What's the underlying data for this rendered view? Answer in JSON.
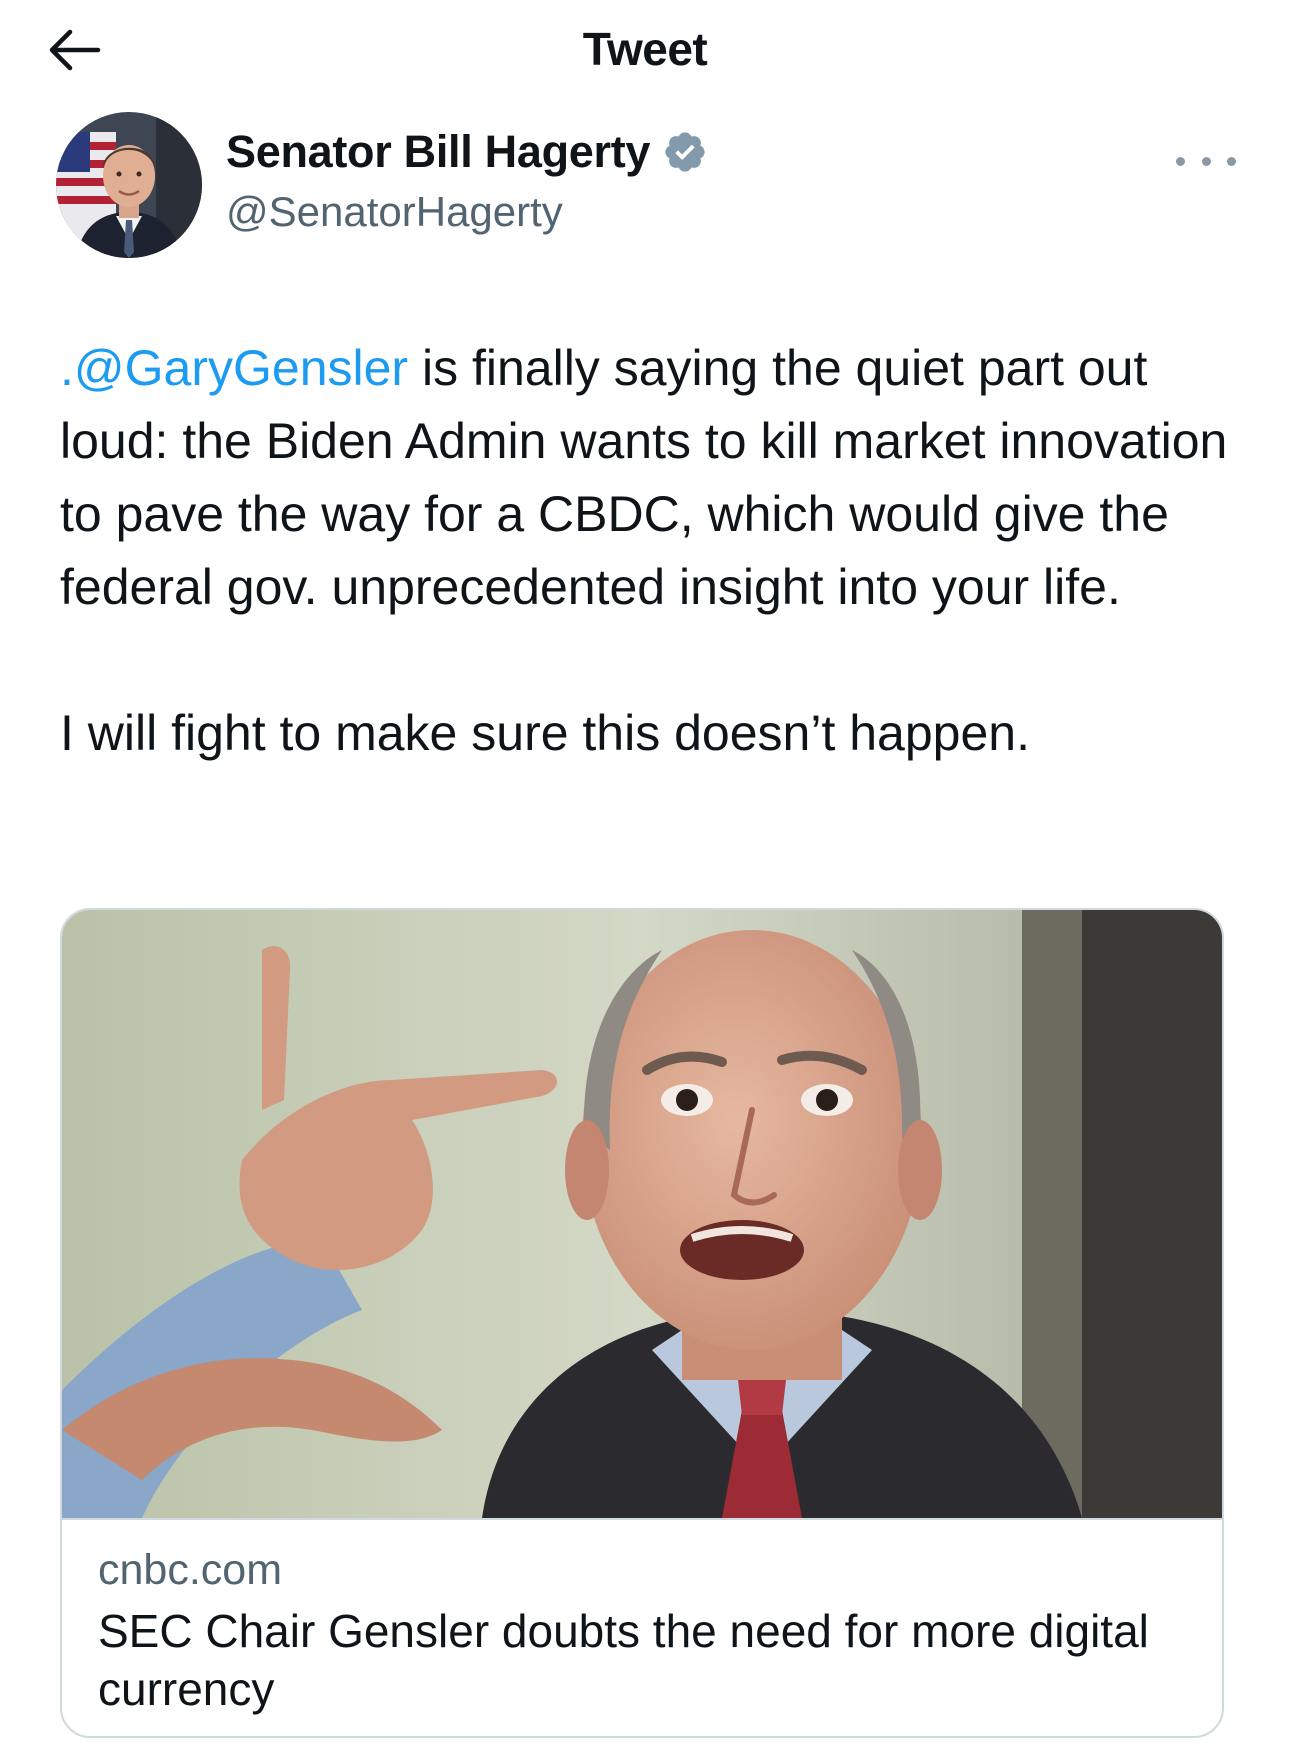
{
  "header": {
    "title": "Tweet",
    "back_icon": "arrow-left-icon"
  },
  "author": {
    "name": "Senator Bill Hagerty",
    "handle": "@SenatorHagerty",
    "verified": true,
    "verified_color": "#829aab"
  },
  "tweet": {
    "mention": ".@GaryGensler",
    "text_line1_rest": " is finally saying the quiet part out loud: the Biden Admin wants to kill market innovation to pave the way for a CBDC, which would give the federal gov. unprecedented insight into your life.",
    "text_para2": "I will fight to make sure this doesn’t happen."
  },
  "link_card": {
    "domain": "cnbc.com",
    "title": "SEC Chair Gensler doubts the need for more digital currency"
  },
  "colors": {
    "accent": "#1d9bf0",
    "secondary_text": "#536471",
    "border": "#cfd9de"
  }
}
